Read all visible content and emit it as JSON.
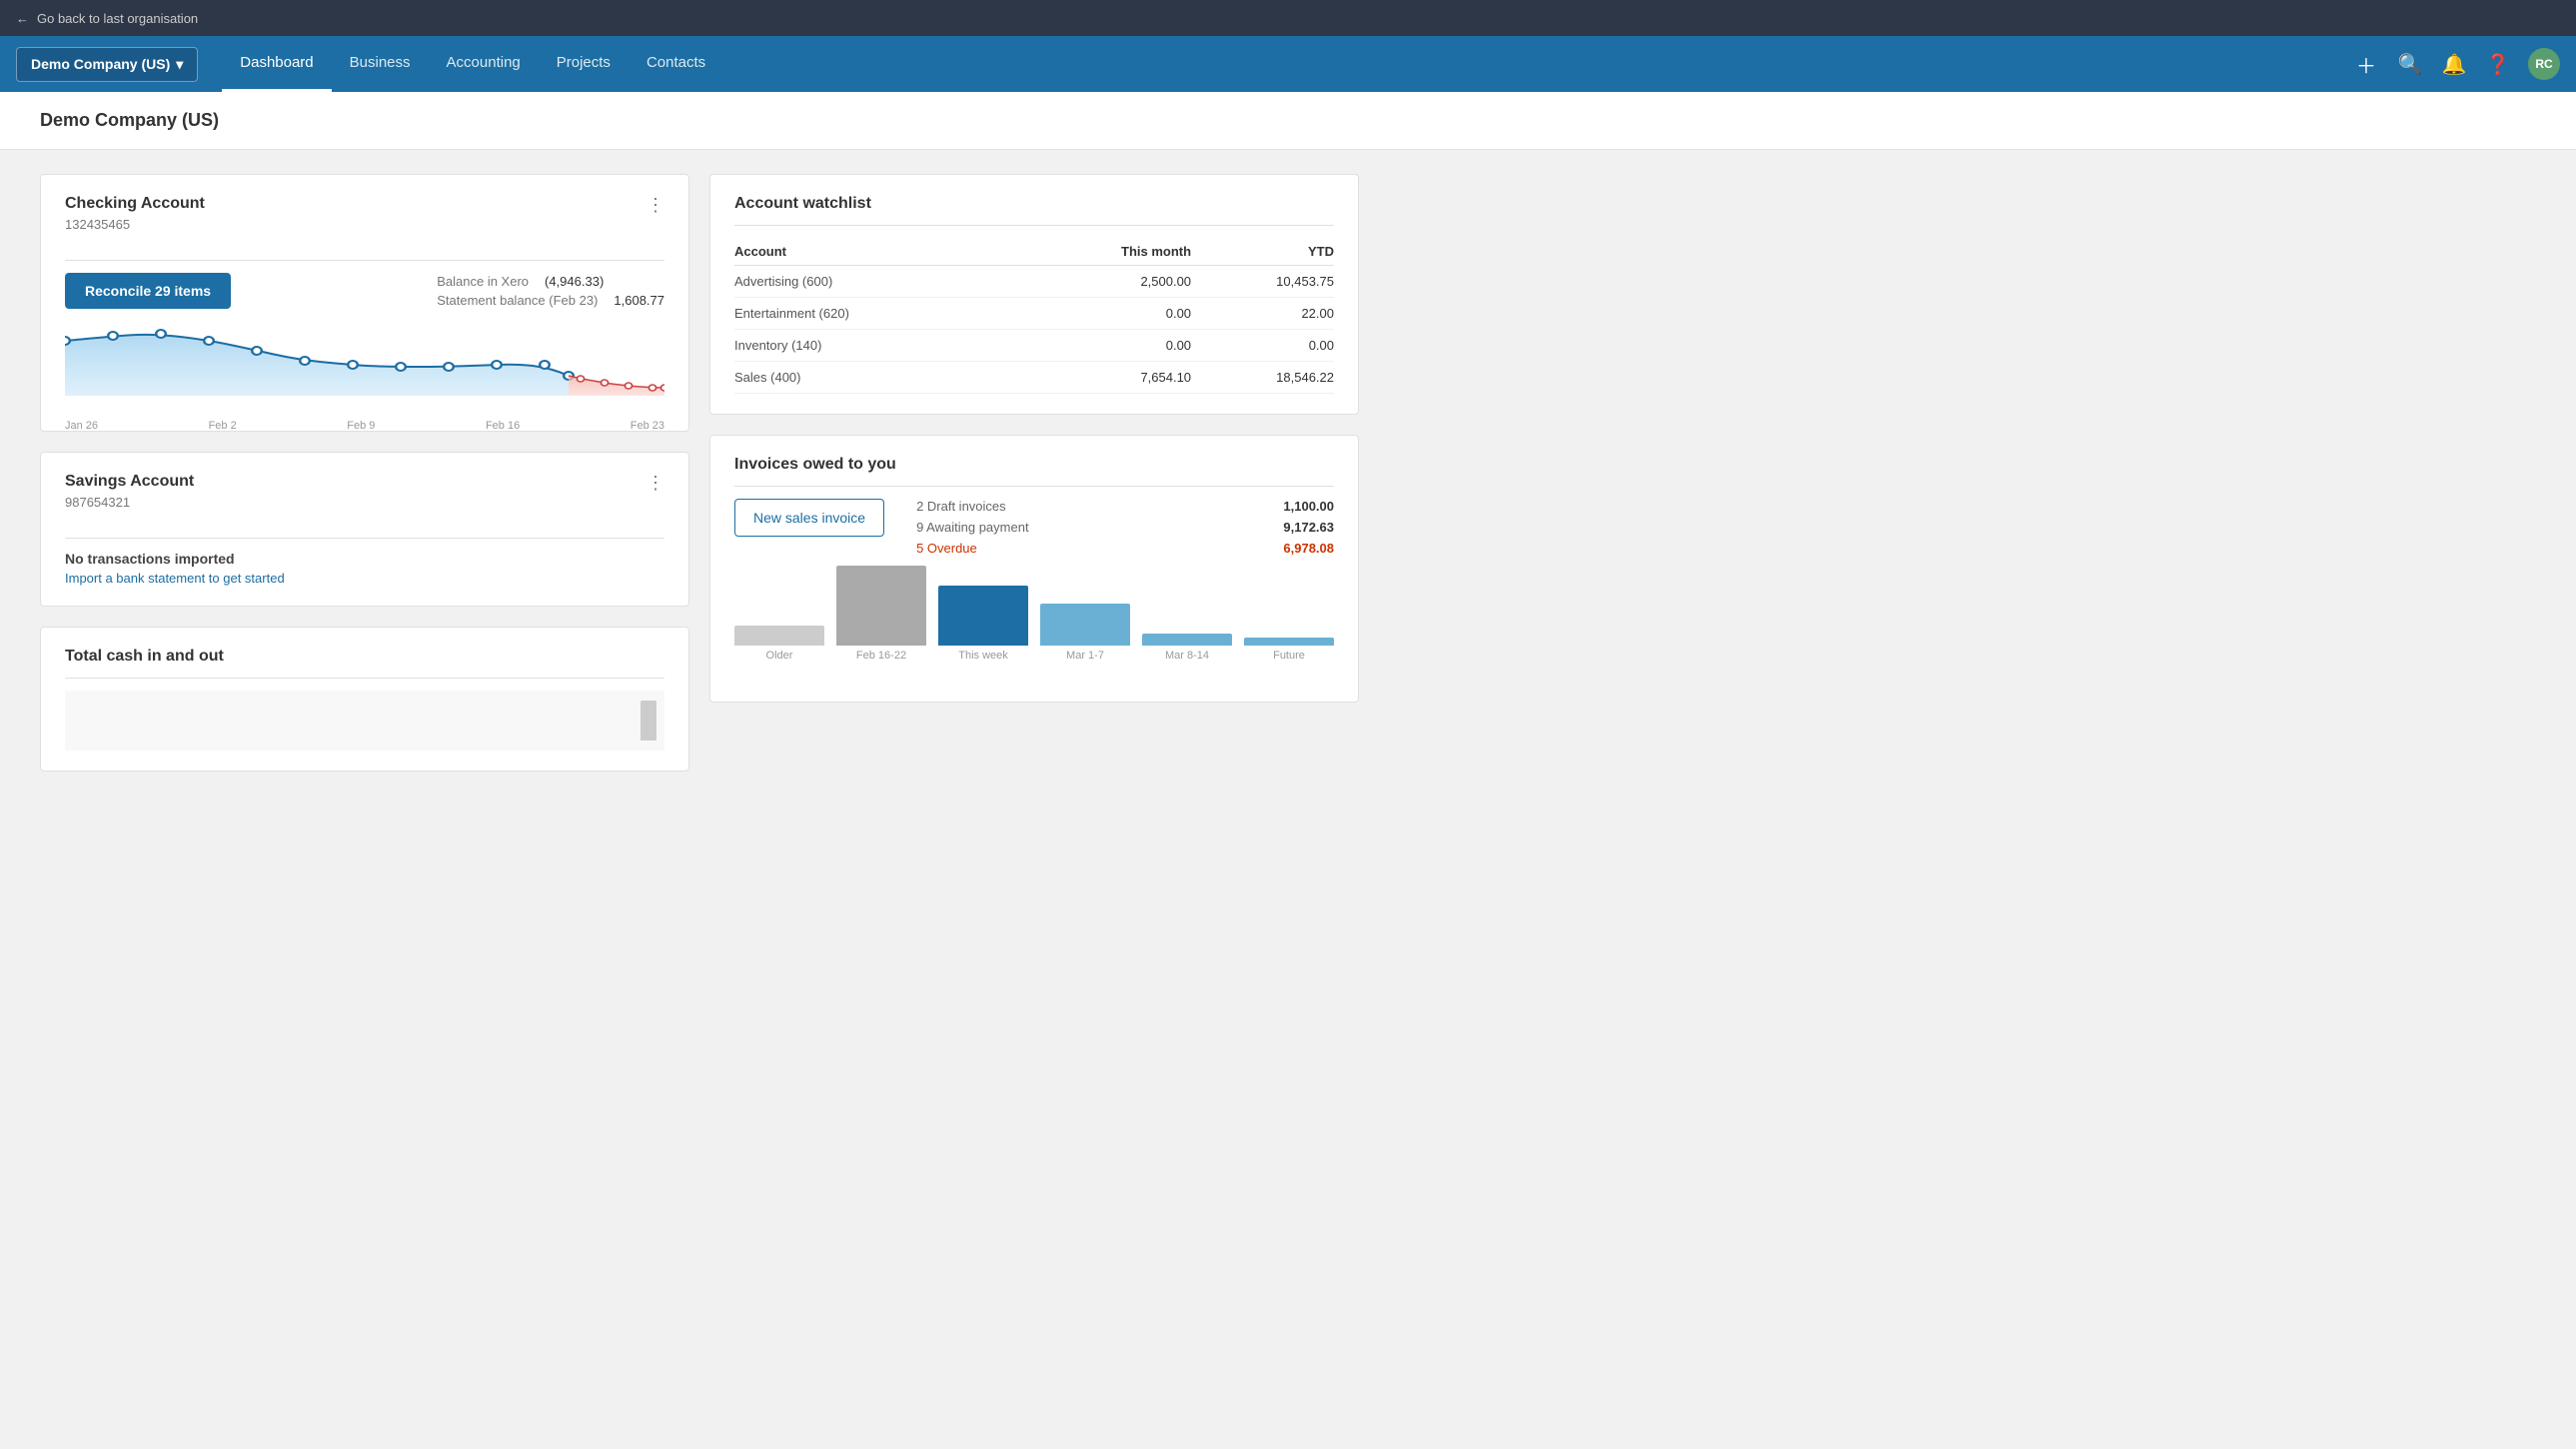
{
  "topbar": {
    "back_label": "Go back to last organisation"
  },
  "nav": {
    "org_name": "Demo Company (US)",
    "links": [
      {
        "label": "Dashboard",
        "active": true
      },
      {
        "label": "Business",
        "active": false
      },
      {
        "label": "Accounting",
        "active": false
      },
      {
        "label": "Projects",
        "active": false
      },
      {
        "label": "Contacts",
        "active": false
      }
    ],
    "avatar": "RC"
  },
  "page_title": "Demo Company (US)",
  "checking_account": {
    "title": "Checking Account",
    "account_number": "132435465",
    "reconcile_btn": "Reconcile 29 items",
    "balance_in_xero_label": "Balance in Xero",
    "balance_in_xero_value": "(4,946.33)",
    "statement_balance_label": "Statement balance (Feb 23)",
    "statement_balance_value": "1,608.77",
    "chart_labels": [
      "Jan 26",
      "Feb 2",
      "Feb 9",
      "Feb 16",
      "Feb 23"
    ]
  },
  "savings_account": {
    "title": "Savings Account",
    "account_number": "987654321",
    "no_transactions": "No transactions imported",
    "import_link": "Import a bank statement to get started"
  },
  "total_cash": {
    "title": "Total cash in and out"
  },
  "account_watchlist": {
    "title": "Account watchlist",
    "col_this_month": "This month",
    "col_ytd": "YTD",
    "rows": [
      {
        "account": "Advertising (600)",
        "this_month": "2,500.00",
        "ytd": "10,453.75"
      },
      {
        "account": "Entertainment (620)",
        "this_month": "0.00",
        "ytd": "22.00"
      },
      {
        "account": "Inventory (140)",
        "this_month": "0.00",
        "ytd": "0.00"
      },
      {
        "account": "Sales (400)",
        "this_month": "7,654.10",
        "ytd": "18,546.22"
      }
    ]
  },
  "invoices_owed": {
    "title": "Invoices owed to you",
    "new_invoice_btn": "New sales invoice",
    "draft_label": "2 Draft invoices",
    "draft_value": "1,100.00",
    "awaiting_label": "9 Awaiting payment",
    "awaiting_value": "9,172.63",
    "overdue_label": "5 Overdue",
    "overdue_value": "6,978.08",
    "chart_bars": [
      {
        "label": "Older",
        "height": 20,
        "color": "#cccccc"
      },
      {
        "label": "Feb 16-22",
        "height": 80,
        "color": "#aaaaaa"
      },
      {
        "label": "This week",
        "height": 60,
        "color": "#1c6ea4"
      },
      {
        "label": "Mar 1-7",
        "height": 42,
        "color": "#6ab0d4"
      },
      {
        "label": "Mar 8-14",
        "height": 12,
        "color": "#6ab0d4"
      },
      {
        "label": "Future",
        "height": 8,
        "color": "#6ab0d4"
      }
    ]
  }
}
